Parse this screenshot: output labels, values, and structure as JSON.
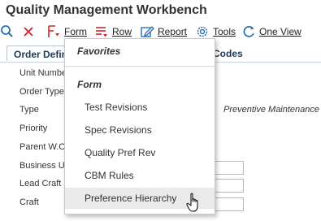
{
  "app": {
    "title": "Quality Management Workbench"
  },
  "toolbar": {
    "form_label": "Form",
    "row_label": "Row",
    "report_label": "Report",
    "tools_label": "Tools",
    "oneview_label": "One View"
  },
  "tabs": {
    "active": "Order Definition",
    "codes": "Codes"
  },
  "fields": {
    "labels": [
      "Unit Number",
      "Order Type",
      "Type",
      "Priority",
      "Parent W.O.",
      "Business Unit",
      "Lead Craft",
      "Craft"
    ],
    "type_value": "Preventive Maintenance"
  },
  "menu": {
    "favorites_header": "Favorites",
    "form_header": "Form",
    "items": [
      "Test Revisions",
      "Spec Revisions",
      "Quality Pref Rev",
      "CBM Rules",
      "Preference Hierarchy"
    ]
  },
  "colors": {
    "icon_blue": "#2a6fb0",
    "icon_red": "#d2232a",
    "text": "#333333"
  }
}
